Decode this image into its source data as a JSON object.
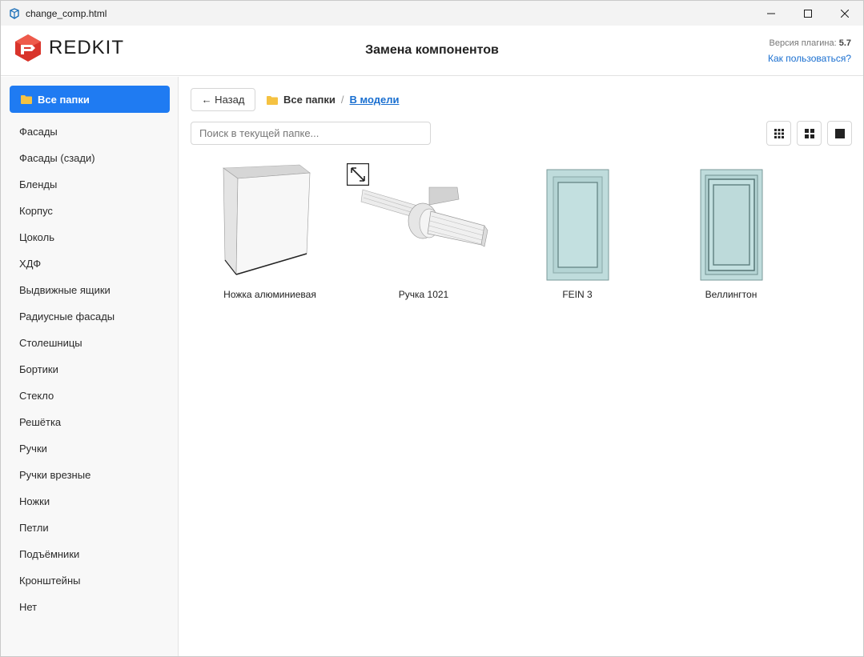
{
  "window": {
    "title": "change_comp.html",
    "minimize_glyph": "—",
    "maximize_glyph": "☐",
    "close_glyph": "✕"
  },
  "header": {
    "logo_text": "REDKIT",
    "title": "Замена компонентов",
    "version_label": "Версия плагина:",
    "version_value": "5.7",
    "howto_link": "Как пользоваться?"
  },
  "sidebar": {
    "active_label": "Все папки",
    "items": [
      "Фасады",
      "Фасады (сзади)",
      "Бленды",
      "Корпус",
      "Цоколь",
      "ХДФ",
      "Выдвижные ящики",
      "Радиусные фасады",
      "Столешницы",
      "Бортики",
      "Стекло",
      "Решётка",
      "Ручки",
      "Ручки врезные",
      "Ножки",
      "Петли",
      "Подъёмники",
      "Кронштейны",
      "Нет"
    ]
  },
  "toolbar": {
    "back_label": "← Назад",
    "breadcrumb_root": "Все папки",
    "breadcrumb_sep": "/",
    "breadcrumb_current": "В модели",
    "search_placeholder": "Поиск в текущей папке..."
  },
  "items": [
    {
      "label": "Ножка алюминиевая",
      "icon": "leg-block-thumbnail"
    },
    {
      "label": "Ручка 1021",
      "icon": "handle-thumbnail"
    },
    {
      "label": "FEIN 3",
      "icon": "facade-panel-thumbnail"
    },
    {
      "label": "Веллингтон",
      "icon": "facade-panel-framed-thumbnail"
    }
  ],
  "colors": {
    "accent": "#1f7bf2",
    "link": "#1a6fd0",
    "logo_red": "#d9342b",
    "folder": "#f5c242",
    "facade": "#bfdcdc"
  }
}
